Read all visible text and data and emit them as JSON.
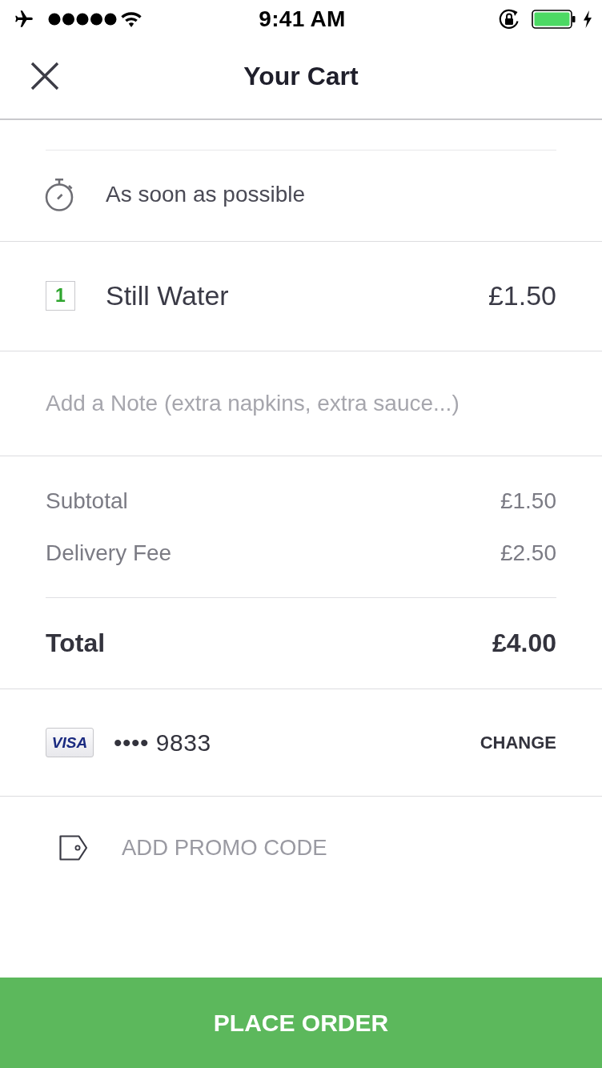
{
  "status_bar": {
    "time": "9:41 AM"
  },
  "header": {
    "title": "Your Cart"
  },
  "delivery_time": {
    "label": "As soon as possible"
  },
  "items": [
    {
      "quantity": "1",
      "name": "Still Water",
      "price": "£1.50"
    }
  ],
  "note": {
    "placeholder": "Add a Note (extra napkins, extra sauce...)"
  },
  "summary": {
    "lines": [
      {
        "label": "Subtotal",
        "value": "£1.50"
      },
      {
        "label": "Delivery Fee",
        "value": "£2.50"
      }
    ],
    "total": {
      "label": "Total",
      "value": "£4.00"
    }
  },
  "payment": {
    "card_brand": "VISA",
    "masked_number": "•••• 9833",
    "action": "CHANGE"
  },
  "promo": {
    "label": "ADD PROMO CODE"
  },
  "place_order": {
    "label": "PLACE ORDER"
  }
}
